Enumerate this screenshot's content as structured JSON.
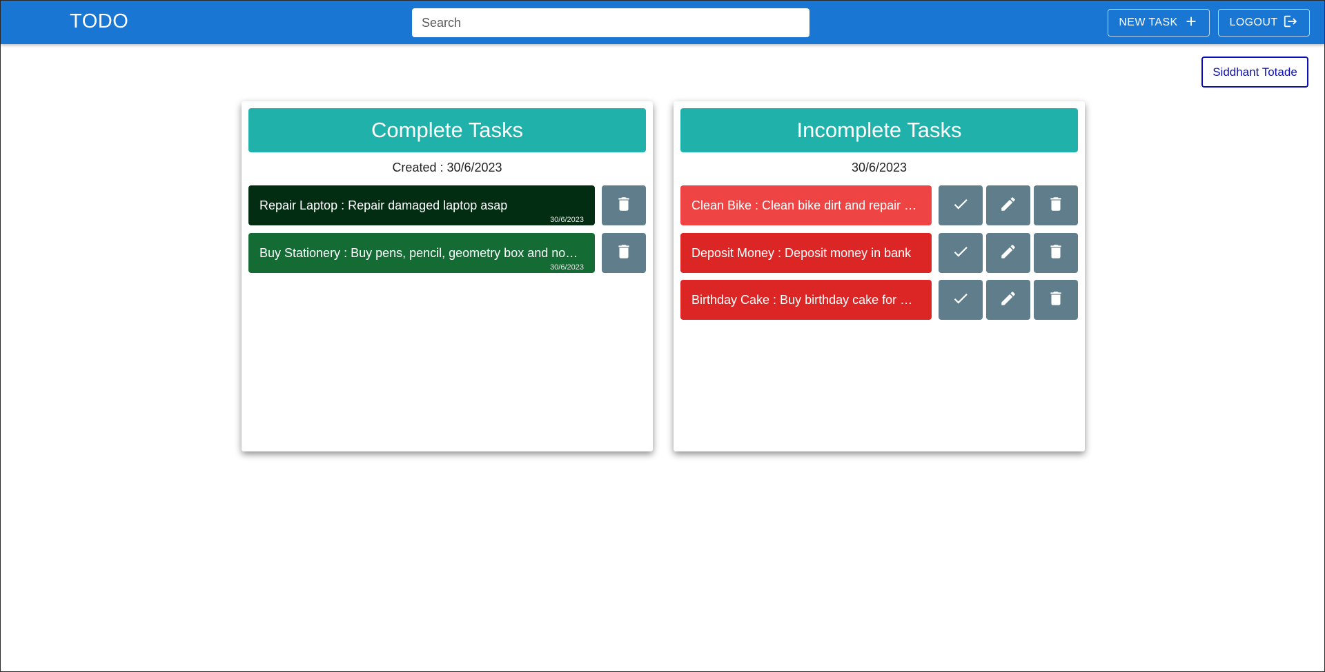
{
  "appbar": {
    "brand": "TODO",
    "search_placeholder": "Search",
    "new_task_label": "NEW TASK",
    "logout_label": "LOGOUT"
  },
  "user": {
    "name": "Siddhant Totade"
  },
  "complete": {
    "title": "Complete Tasks",
    "date_text": "Created : 30/6/2023",
    "tasks": [
      {
        "text": "Repair Laptop : Repair damaged laptop asap",
        "date": "30/6/2023",
        "color": "#022d13"
      },
      {
        "text": "Buy Stationery : Buy pens, pencil, geometry box and notebooks",
        "date": "30/6/2023",
        "color": "#146c34"
      }
    ]
  },
  "incomplete": {
    "title": "Incomplete Tasks",
    "date_text": "30/6/2023",
    "tasks": [
      {
        "text": "Clean Bike : Clean bike dirt and repair brakes",
        "color": "#ef4444"
      },
      {
        "text": "Deposit Money : Deposit money in bank",
        "color": "#dc2626"
      },
      {
        "text": "Birthday Cake : Buy birthday cake for party",
        "color": "#dc2626"
      }
    ]
  },
  "colors": {
    "appbar": "#1976d2",
    "panel_header": "#20b2aa",
    "icon_button": "#607d8b",
    "user_button": "#0a0fb5"
  },
  "icons": [
    "plus-icon",
    "logout-icon",
    "delete-icon",
    "check-icon",
    "edit-icon"
  ]
}
